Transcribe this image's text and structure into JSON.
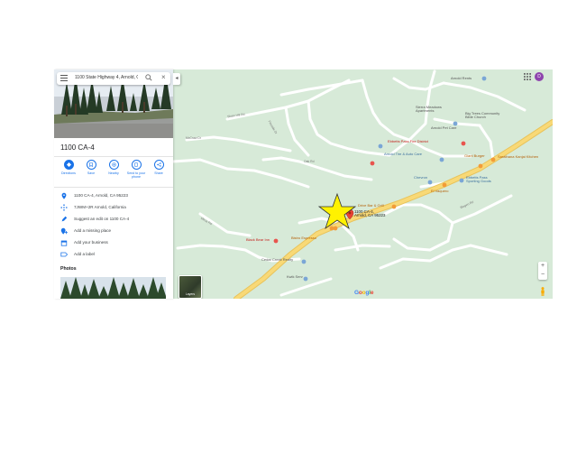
{
  "search": {
    "query": "1100 State Highway 4, Arnold, CA"
  },
  "place": {
    "title": "1100 CA-4",
    "actions": [
      {
        "label": "Directions",
        "icon": "directions-icon"
      },
      {
        "label": "Save",
        "icon": "bookmark-icon"
      },
      {
        "label": "Nearby",
        "icon": "nearby-icon"
      },
      {
        "label": "Send to your phone",
        "icon": "phone-icon"
      },
      {
        "label": "Share",
        "icon": "share-icon"
      }
    ],
    "address": "1100 CA-4, Arnold, CA 95223",
    "plus_code": "7JWM+2R Arnold, California",
    "suggest_edit": "Suggest an edit on 1100 CA-4",
    "add_missing": "Add a missing place",
    "add_business": "Add your business",
    "add_label": "Add a label",
    "photos_heading": "Photos"
  },
  "map": {
    "labels": {
      "arnold_rents": "Arnold Rents",
      "sierra_meadows": "Sierra Meadows\nApartments",
      "big_trees_church": "Big Trees Community\nBible Church",
      "arnold_pet_care": "Arnold Pet Care",
      "ebbetts_fire": "Ebbetts Pass Fire District",
      "arnold_tire": "Arnold Tire & Auto Care",
      "giant_burger": "Giant Burger",
      "sarathana": "Sarathana Kanjai Kitchen",
      "chevron": "Chevron",
      "ebbetts_sporting": "Ebbetts Pass\nSporting Goods",
      "el_vaquero": "El Vaquero",
      "cafe": "Drive Bar & Grill",
      "pin_label": "1100 CA-4,\nArnold, CA 95223",
      "black_bear": "Black Bear Inn",
      "bistro": "Bistro Espresso",
      "cedar_creek": "Cedar Creek Realty",
      "kwik_serv": "Kwik Serv"
    },
    "streets": [
      "Sloan Hill Rd",
      "Fireside Dr",
      "McCraw Dr",
      "Oak Rd",
      "Mesa Rd",
      "Blagen Rd"
    ],
    "profile_initial": "D",
    "layers_label": "Layers",
    "zoom_in": "+",
    "zoom_out": "−",
    "google_logo": "Google"
  }
}
